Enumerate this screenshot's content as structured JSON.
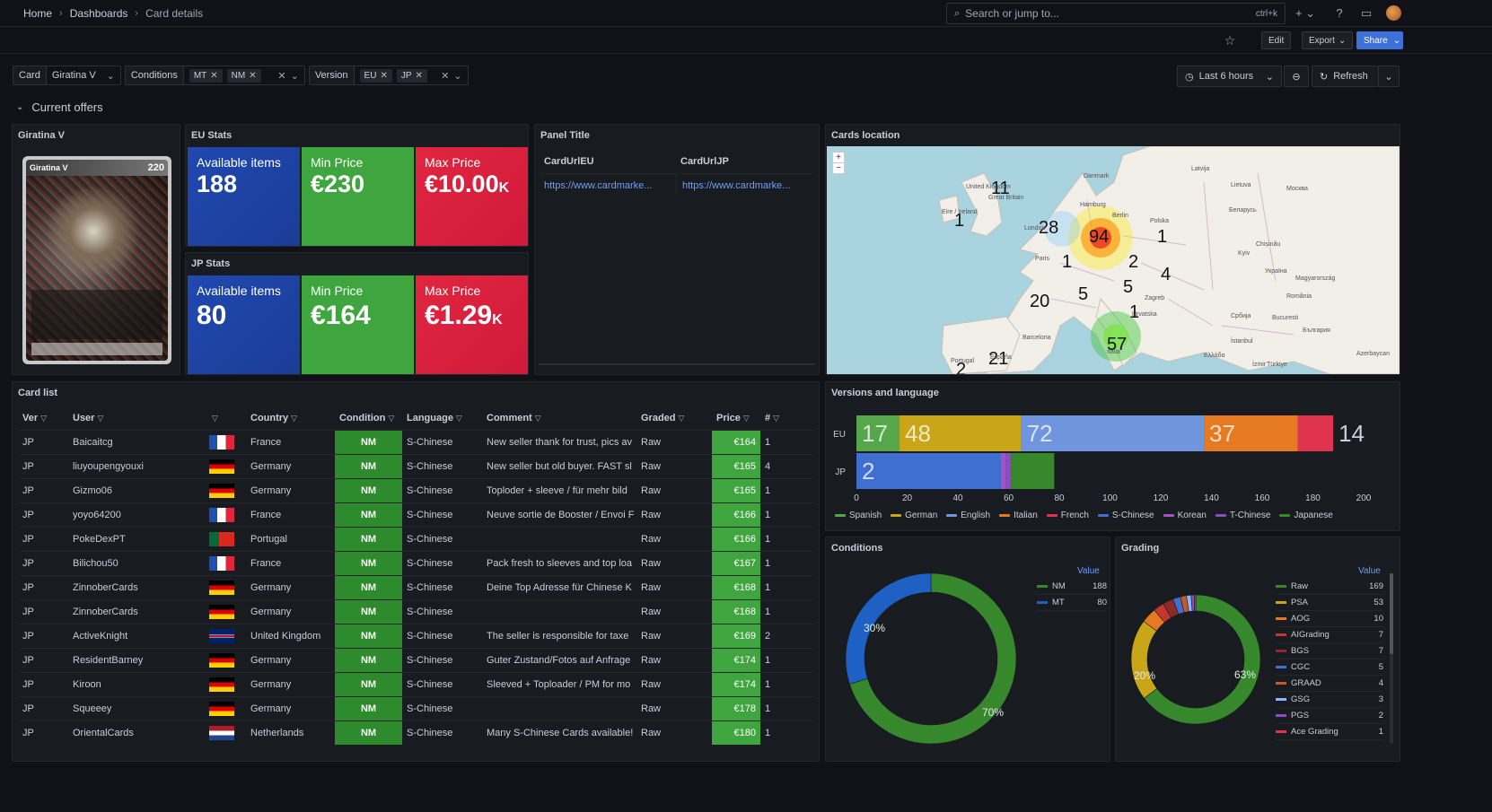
{
  "breadcrumb": {
    "home": "Home",
    "dashboards": "Dashboards",
    "current": "Card details"
  },
  "search": {
    "placeholder": "Search or jump to...",
    "shortcut": "ctrl+k"
  },
  "toolbar": {
    "edit": "Edit",
    "export": "Export",
    "share": "Share"
  },
  "variables": {
    "card": {
      "label": "Card",
      "value": "Giratina V"
    },
    "conditions": {
      "label": "Conditions",
      "chips": [
        "MT",
        "NM"
      ]
    },
    "version": {
      "label": "Version",
      "chips": [
        "EU",
        "JP"
      ]
    }
  },
  "time": {
    "range": "Last 6 hours",
    "refresh": "Refresh"
  },
  "row": {
    "title": "Current offers"
  },
  "card_panel": {
    "title": "Giratina V",
    "card_name": "Giratina V",
    "card_hp": "220"
  },
  "eu_stats": {
    "title": "EU Stats",
    "available_label": "Available items",
    "available": "188",
    "min_label": "Min Price",
    "min": "€230",
    "max_label": "Max Price",
    "max": "€10.00",
    "max_suffix": "K"
  },
  "jp_stats": {
    "title": "JP Stats",
    "available_label": "Available items",
    "available": "80",
    "min_label": "Min Price",
    "min": "€164",
    "max_label": "Max Price",
    "max": "€1.29",
    "max_suffix": "K"
  },
  "panel_title": {
    "title": "Panel Title",
    "col1": "CardUrlEU",
    "col2": "CardUrlJP",
    "url1": "https://www.cardmarke...",
    "url2": "https://www.cardmarke..."
  },
  "map": {
    "title": "Cards location",
    "zoom_in": "+",
    "zoom_out": "−",
    "clusters": [
      "11",
      "1",
      "28",
      "94",
      "1",
      "1",
      "2",
      "4",
      "5",
      "5",
      "20",
      "1",
      "57",
      "21",
      "2"
    ],
    "places": [
      "United Kingdom",
      "Great Britain",
      "Eire / Ireland",
      "London",
      "Hamburg",
      "Berlin",
      "Danmark",
      "Paris",
      "Zagreb",
      "Hrvatska",
      "Barcelona",
      "España",
      "Portugal",
      "Latvija",
      "Lietuva",
      "Москва",
      "Беларусь",
      "Polska",
      "Україна",
      "Magyarország",
      "Chișinău",
      "România",
      "Bucuresti",
      "България",
      "Србија",
      "İstanbul",
      "Türkiye",
      "Azerbaycan",
      "Kyiv",
      "Ελλάδα",
      "Italia",
      "İzmir"
    ]
  },
  "card_list": {
    "title": "Card list",
    "columns": [
      "Ver",
      "User",
      "",
      "Country",
      "Condition",
      "Language",
      "Comment",
      "Graded",
      "Price",
      "#"
    ],
    "rows": [
      {
        "ver": "JP",
        "user": "Baicaitcg",
        "flag": "fr",
        "country": "France",
        "condition": "NM",
        "language": "S-Chinese",
        "comment": "New seller thank for trust, pics av",
        "graded": "Raw",
        "price": "€164",
        "count": "1"
      },
      {
        "ver": "JP",
        "user": "liuyoupengyouxi",
        "flag": "de",
        "country": "Germany",
        "condition": "NM",
        "language": "S-Chinese",
        "comment": "New seller but old buyer. FAST sl",
        "graded": "Raw",
        "price": "€165",
        "count": "4"
      },
      {
        "ver": "JP",
        "user": "Gizmo06",
        "flag": "de",
        "country": "Germany",
        "condition": "NM",
        "language": "S-Chinese",
        "comment": "Toploder + sleeve / für mehr bild",
        "graded": "Raw",
        "price": "€165",
        "count": "1"
      },
      {
        "ver": "JP",
        "user": "yoyo64200",
        "flag": "fr",
        "country": "France",
        "condition": "NM",
        "language": "S-Chinese",
        "comment": "Neuve sortie de Booster / Envoi F",
        "graded": "Raw",
        "price": "€166",
        "count": "1"
      },
      {
        "ver": "JP",
        "user": "PokeDexPT",
        "flag": "pt",
        "country": "Portugal",
        "condition": "NM",
        "language": "S-Chinese",
        "comment": "",
        "graded": "Raw",
        "price": "€166",
        "count": "1"
      },
      {
        "ver": "JP",
        "user": "Bilichou50",
        "flag": "fr",
        "country": "France",
        "condition": "NM",
        "language": "S-Chinese",
        "comment": "Pack fresh to sleeves and top loa",
        "graded": "Raw",
        "price": "€167",
        "count": "1"
      },
      {
        "ver": "JP",
        "user": "ZinnoberCards",
        "flag": "de",
        "country": "Germany",
        "condition": "NM",
        "language": "S-Chinese",
        "comment": "Deine Top Adresse für Chinese K",
        "graded": "Raw",
        "price": "€168",
        "count": "1"
      },
      {
        "ver": "JP",
        "user": "ZinnoberCards",
        "flag": "de",
        "country": "Germany",
        "condition": "NM",
        "language": "S-Chinese",
        "comment": "",
        "graded": "Raw",
        "price": "€168",
        "count": "1"
      },
      {
        "ver": "JP",
        "user": "ActiveKnight",
        "flag": "gb",
        "country": "United Kingdom",
        "condition": "NM",
        "language": "S-Chinese",
        "comment": "The seller is responsible for taxe",
        "graded": "Raw",
        "price": "€169",
        "count": "2"
      },
      {
        "ver": "JP",
        "user": "ResidentBarney",
        "flag": "de",
        "country": "Germany",
        "condition": "NM",
        "language": "S-Chinese",
        "comment": "Guter Zustand/Fotos auf Anfrage",
        "graded": "Raw",
        "price": "€174",
        "count": "1"
      },
      {
        "ver": "JP",
        "user": "Kiroon",
        "flag": "de",
        "country": "Germany",
        "condition": "NM",
        "language": "S-Chinese",
        "comment": "Sleeved + Toploader / PM for mo",
        "graded": "Raw",
        "price": "€174",
        "count": "1"
      },
      {
        "ver": "JP",
        "user": "Squeeey",
        "flag": "de",
        "country": "Germany",
        "condition": "NM",
        "language": "S-Chinese",
        "comment": "",
        "graded": "Raw",
        "price": "€178",
        "count": "1"
      },
      {
        "ver": "JP",
        "user": "OrientalCards",
        "flag": "nl",
        "country": "Netherlands",
        "condition": "NM",
        "language": "S-Chinese",
        "comment": "Many S-Chinese Cards available!",
        "graded": "Raw",
        "price": "€180",
        "count": "1"
      }
    ]
  },
  "chart_data": [
    {
      "type": "bar",
      "orientation": "horizontal-stacked",
      "title": "Versions and language",
      "categories": [
        "EU",
        "JP"
      ],
      "xlim": [
        0,
        200
      ],
      "xticks": [
        "0",
        "20",
        "40",
        "60",
        "80",
        "100",
        "120",
        "140",
        "160",
        "180",
        "200"
      ],
      "series": [
        {
          "name": "Spanish",
          "color": "#56a64b",
          "values": [
            17,
            0
          ]
        },
        {
          "name": "German",
          "color": "#c8a618",
          "values": [
            48,
            0
          ]
        },
        {
          "name": "English",
          "color": "#6e95de",
          "values": [
            72,
            0
          ]
        },
        {
          "name": "Italian",
          "color": "#e57a22",
          "values": [
            37,
            0
          ]
        },
        {
          "name": "French",
          "color": "#e0334d",
          "values": [
            14,
            0
          ]
        },
        {
          "name": "S-Chinese",
          "color": "#3f6fd1",
          "values": [
            0,
            57
          ]
        },
        {
          "name": "Korean",
          "color": "#a352cc",
          "values": [
            0,
            2
          ]
        },
        {
          "name": "T-Chinese",
          "color": "#8a4ec4",
          "values": [
            0,
            2
          ]
        },
        {
          "name": "Japanese",
          "color": "#37872d",
          "values": [
            0,
            17
          ]
        }
      ],
      "bar_labels": {
        "EU": [
          "17",
          "48",
          "72",
          "37",
          "14"
        ],
        "JP": [
          "2",
          "17"
        ]
      },
      "legend": "bottom"
    },
    {
      "type": "pie",
      "title": "Conditions",
      "legend_header": "Value",
      "slices": [
        {
          "label": "NM",
          "value": 188,
          "color": "#37872d"
        },
        {
          "label": "MT",
          "value": 80,
          "color": "#1f60c4"
        }
      ],
      "slice_labels": [
        "70%",
        "30%"
      ],
      "legend": "right"
    },
    {
      "type": "pie",
      "title": "Grading",
      "legend_header": "Value",
      "slices": [
        {
          "label": "Raw",
          "value": 169,
          "color": "#37872d"
        },
        {
          "label": "PSA",
          "value": 53,
          "color": "#c8a618"
        },
        {
          "label": "AOG",
          "value": 10,
          "color": "#e57a22"
        },
        {
          "label": "AIGrading",
          "value": 7,
          "color": "#c4372d"
        },
        {
          "label": "BGS",
          "value": 7,
          "color": "#8f2a2a"
        },
        {
          "label": "CGC",
          "value": 5,
          "color": "#3f6fd1"
        },
        {
          "label": "GRAAD",
          "value": 4,
          "color": "#c55a2a"
        },
        {
          "label": "GSG",
          "value": 3,
          "color": "#8ab8ff"
        },
        {
          "label": "PGS",
          "value": 2,
          "color": "#8a4ec4"
        },
        {
          "label": "Ace Grading",
          "value": 1,
          "color": "#e0334d"
        }
      ],
      "slice_labels": [
        "63%",
        "20%"
      ],
      "legend": "right"
    }
  ]
}
